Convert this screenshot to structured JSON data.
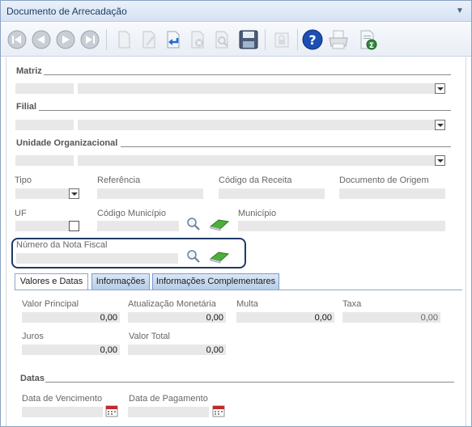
{
  "window": {
    "title": "Documento de Arrecadação",
    "collapse_glyph": "▼"
  },
  "toolbar": {
    "buttons": [
      {
        "name": "first-record-button",
        "icon": "skip-first-icon"
      },
      {
        "name": "previous-record-button",
        "icon": "previous-icon"
      },
      {
        "name": "next-record-button",
        "icon": "next-icon"
      },
      {
        "name": "last-record-button",
        "icon": "skip-last-icon"
      },
      {
        "name": "new-document-button",
        "icon": "new-document-icon"
      },
      {
        "name": "edit-button",
        "icon": "pencil-icon"
      },
      {
        "name": "undo-button",
        "icon": "undo-icon"
      },
      {
        "name": "delete-button",
        "icon": "delete-icon"
      },
      {
        "name": "search-button",
        "icon": "magnify-icon"
      },
      {
        "name": "save-button",
        "icon": "floppy-disk-icon"
      },
      {
        "name": "lock-button",
        "icon": "lock-icon"
      },
      {
        "name": "help-button",
        "icon": "help-icon"
      },
      {
        "name": "print-button",
        "icon": "printer-icon"
      },
      {
        "name": "export-excel-button",
        "icon": "excel-export-icon"
      }
    ]
  },
  "sections": {
    "matriz": "Matriz",
    "filial": "Filial",
    "unidade": "Unidade Organizacional",
    "datas": "Datas"
  },
  "labels": {
    "tipo": "Tipo",
    "referencia": "Referência",
    "codigo_receita": "Código da Receita",
    "documento_origem": "Documento de Origem",
    "uf": "UF",
    "codigo_municipio": "Código Município",
    "municipio": "Município",
    "numero_nota": "Número da Nota Fiscal"
  },
  "tabs": [
    {
      "label": "Valores e Datas",
      "active": true
    },
    {
      "label": "Informações",
      "active": false
    },
    {
      "label": "Informações Complementares",
      "active": false
    }
  ],
  "values_tab": {
    "valor_principal_label": "Valor Principal",
    "valor_principal": "0,00",
    "atualizacao_label": "Atualização Monetária",
    "atualizacao": "0,00",
    "multa_label": "Multa",
    "multa": "0,00",
    "taxa_label": "Taxa",
    "taxa": "0,00",
    "juros_label": "Juros",
    "juros": "0,00",
    "valor_total_label": "Valor Total",
    "valor_total": "0,00",
    "data_vencimento_label": "Data de Vencimento",
    "data_pagamento_label": "Data de Pagamento"
  },
  "colors": {
    "highlight_border": "#1f3a66",
    "field_bg": "#e8e8e8",
    "tab_bg": "#b7cde8"
  }
}
